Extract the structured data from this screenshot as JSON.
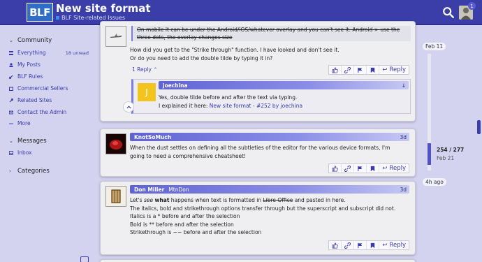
{
  "header": {
    "logo": "BLF",
    "title": "New site format",
    "subtitle": "BLF Site-related Issues",
    "notification_count": "1"
  },
  "sidebar": {
    "community_label": "Community",
    "items": [
      {
        "label": "Everything",
        "count": "18 unread"
      },
      {
        "label": "My Posts"
      },
      {
        "label": "BLF Rules"
      },
      {
        "label": "Commercial Sellers"
      },
      {
        "label": "Related Sites"
      },
      {
        "label": "Contact the Admin"
      },
      {
        "label": "More"
      }
    ],
    "messages_label": "Messages",
    "inbox_label": "Inbox",
    "categories_label": "Categories"
  },
  "posts": [
    {
      "quote_line1": "On mobile it can be under the Android/iOS/whatever overlay and you can't see it. Android > use the",
      "quote_line2": "three dots, the overlay changes size",
      "line1": "How did you get to the \"Strike through\" function. I have looked and don't see it.",
      "line2": "Or do you need to add the double tilde by typing it in?",
      "replies_label": "1 Reply",
      "reply_label": "Reply",
      "nested": {
        "author": "joechina",
        "avatar_letter": "J",
        "line1": "Yes, double tilde before and after the text via typing.",
        "line2_prefix": "I explained it here: ",
        "link_text": "New site format - #252 by joechina"
      }
    },
    {
      "author": "KnotSoMuch",
      "date": "3d",
      "line1": "When the dust settles on defining all the subtleties of the editor for the various device formats, I'm",
      "line2": "going to need a comprehensive cheatsheet!",
      "reply_label": "Reply"
    },
    {
      "author": "Don Miller",
      "username": "MtnDon",
      "date": "3d",
      "line1_a": "Let's ",
      "line1_b": "see",
      "line1_c": " ",
      "line1_d": "what",
      "line1_e": " happens when text is formatted in ",
      "line1_f": "Libre Office",
      "line1_g": " and pasted in here.",
      "line2": "The italics, bold and strikethrough options transfer through but the superscript and subscript did not.",
      "line3": "Italics is a * before and after the selection",
      "line4": "Bold is ** before and after the selection",
      "line5": "Strikethrough is ~~ before and after the selection",
      "reply_label": "Reply"
    }
  ],
  "timeline": {
    "top_date": "Feb 11",
    "position": "254 / 277",
    "position_date": "Feb 21",
    "ago": "4h ago"
  },
  "colors": {
    "header": "#3b3ea8",
    "accent": "#3a3ab0",
    "page_bg": "#d3d3f0"
  }
}
